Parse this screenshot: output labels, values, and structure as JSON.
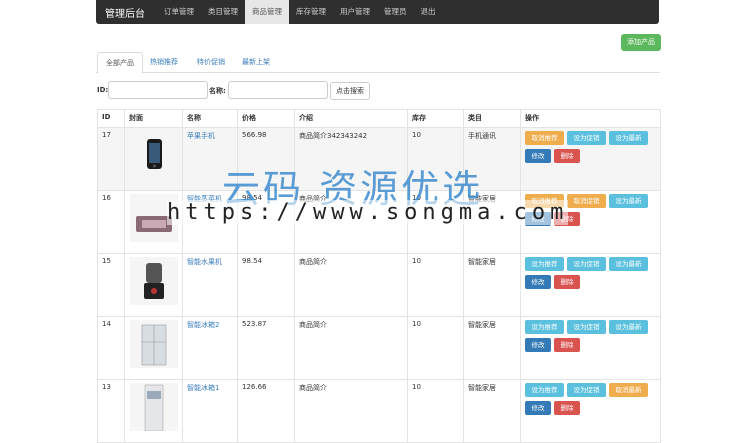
{
  "nav": {
    "brand": "管理后台",
    "items": [
      "订单管理",
      "类目管理",
      "商品管理",
      "库存管理",
      "用户管理",
      "管理员",
      "退出"
    ],
    "active_index": 2
  },
  "add_button": "添加产品",
  "tabs": [
    "全部产品",
    "热销推荐",
    "特价促销",
    "最新上架"
  ],
  "search": {
    "id_label": "ID:",
    "name_label": "名称:",
    "button": "点击搜索"
  },
  "table": {
    "headers": [
      "ID",
      "封面",
      "名称",
      "价格",
      "介绍",
      "库存",
      "类目",
      "操作"
    ],
    "rows": [
      {
        "id": "17",
        "name": "苹果手机",
        "price": "566.98",
        "desc": "商品简介342343242",
        "stock": "10",
        "category": "手机通讯",
        "b1": "取消推荐",
        "b2": "设为促销",
        "b3": "设为最新",
        "edit": "修改",
        "del": "删除"
      },
      {
        "id": "16",
        "name": "智能蒸菜机",
        "price": "98.54",
        "desc": "商品简介",
        "stock": "10",
        "category": "智能家居",
        "b1": "取消推荐",
        "b2": "取消促销",
        "b3": "设为最新",
        "edit": "修改",
        "del": "删除"
      },
      {
        "id": "15",
        "name": "智能水果机",
        "price": "98.54",
        "desc": "商品简介",
        "stock": "10",
        "category": "智能家居",
        "b1": "设为推荐",
        "b2": "设为促销",
        "b3": "设为最新",
        "edit": "修改",
        "del": "删除"
      },
      {
        "id": "14",
        "name": "智能冰箱2",
        "price": "523.87",
        "desc": "商品简介",
        "stock": "10",
        "category": "智能家居",
        "b1": "设为推荐",
        "b2": "设为促销",
        "b3": "设为最新",
        "edit": "修改",
        "del": "删除"
      },
      {
        "id": "13",
        "name": "智能冰箱1",
        "price": "126.66",
        "desc": "商品简介",
        "stock": "10",
        "category": "智能家居",
        "b1": "设为推荐",
        "b2": "设为促销",
        "b3": "取消最新",
        "edit": "修改",
        "del": "删除"
      }
    ]
  },
  "watermark": {
    "text": "云码 资源优选",
    "url": "https://www.songma.com"
  },
  "colors": {
    "nav_bg": "#2f2f2f",
    "success": "#5cb85c",
    "info": "#5bc0de",
    "warning": "#f0ad4e",
    "primary": "#337ab7",
    "danger": "#d9534f",
    "link": "#3a7ec0"
  }
}
